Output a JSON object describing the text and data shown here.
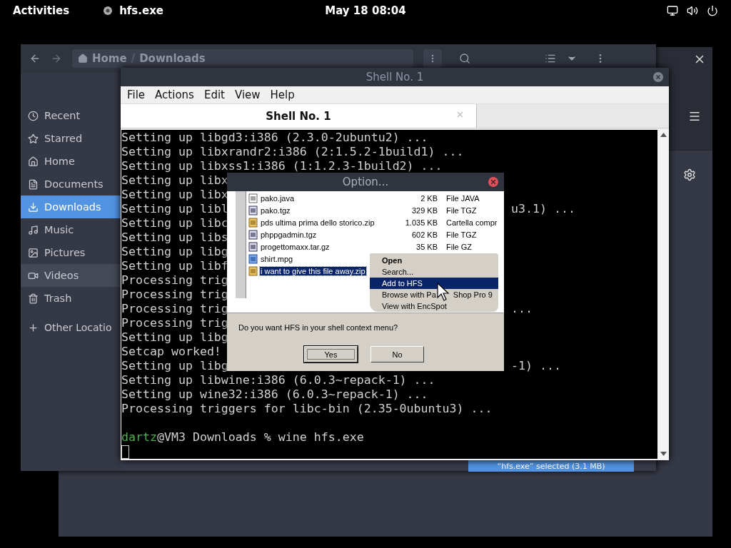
{
  "top_bar": {
    "activities": "Activities",
    "app": "hfs.exe",
    "clock": "May 18 08:04"
  },
  "file_manager": {
    "path": [
      {
        "label": "Home"
      },
      {
        "label": "Downloads"
      }
    ],
    "separator": "/",
    "sidebar": [
      {
        "label": "Recent",
        "selected": false,
        "highlighted": false
      },
      {
        "label": "Starred",
        "selected": false,
        "highlighted": false
      },
      {
        "label": "Home",
        "selected": false,
        "highlighted": false
      },
      {
        "label": "Documents",
        "selected": false,
        "highlighted": false
      },
      {
        "label": "Downloads",
        "selected": true,
        "highlighted": false
      },
      {
        "label": "Music",
        "selected": false,
        "highlighted": false
      },
      {
        "label": "Pictures",
        "selected": false,
        "highlighted": false
      },
      {
        "label": "Videos",
        "selected": false,
        "highlighted": true
      },
      {
        "label": "Trash",
        "selected": false,
        "highlighted": false
      },
      {
        "label": "Other Locatio",
        "selected": false,
        "highlighted": false
      }
    ],
    "status": "“hfs.exe” selected (3.1 MB)"
  },
  "terminal": {
    "title": "Shell No. 1",
    "menu": [
      "File",
      "Actions",
      "Edit",
      "View",
      "Help"
    ],
    "tabs": [
      {
        "label": "Shell No. 1",
        "selected": true
      }
    ],
    "lines": [
      {
        "text": "Setting up libgd3:i386 (2.3.0-2ubuntu2) ..."
      },
      {
        "text": "Setting up libxrandr2:i386 (2:1.5.2-1build1) ..."
      },
      {
        "text": "Setting up libxss1:i386 (1:1.2.3-1build2) ..."
      },
      {
        "text": "Setting up libx"
      },
      {
        "text": "Setting up libx"
      },
      {
        "text": "Setting up libl",
        "tail": "u3.1) ..."
      },
      {
        "text": "Setting up libc"
      },
      {
        "text": "Setting up libs"
      },
      {
        "text": "Setting up libg"
      },
      {
        "text": "Setting up libf"
      },
      {
        "text": "Processing trig"
      },
      {
        "text": "Processing trig"
      },
      {
        "text": "Processing trig",
        "tail": "..."
      },
      {
        "text": "Processing trig"
      },
      {
        "text": "Setting up libg"
      },
      {
        "text": "Setcap worked!"
      },
      {
        "text": "Setting up libg",
        "tail": "-1) ..."
      },
      {
        "text": "Setting up libwine:i386 (6.0.3~repack-1) ..."
      },
      {
        "text": "Setting up wine32:i386 (6.0.3~repack-1) ..."
      },
      {
        "text": "Processing triggers for libc-bin (2.35-0ubuntu3) ..."
      }
    ],
    "prompt": {
      "user": "dartz",
      "rest": "@VM3 Downloads % wine hfs.exe"
    }
  },
  "dialog": {
    "title": "Option...",
    "files": [
      {
        "name": "pako.java",
        "size": "2 KB",
        "type": "File JAVA",
        "kind": "document",
        "selected": false
      },
      {
        "name": "pako.tgz",
        "size": "329 KB",
        "type": "File TGZ",
        "kind": "archive",
        "selected": false
      },
      {
        "name": "pds ultima prima dello storico.zip",
        "size": "1.035 KB",
        "type": "Cartella compr",
        "kind": "zip",
        "selected": false
      },
      {
        "name": "phppgadmin.tgz",
        "size": "602 KB",
        "type": "File TGZ",
        "kind": "archive",
        "selected": false
      },
      {
        "name": "progettomaxx.tar.gz",
        "size": "35 KB",
        "type": "File GZ",
        "kind": "archive",
        "selected": false
      },
      {
        "name": "shirt.mpg",
        "kind": "video",
        "selected": false
      },
      {
        "name": "i want to give this file away.zip",
        "kind": "zip",
        "selected": true
      }
    ],
    "context_menu": [
      {
        "label": "Open",
        "bold": true,
        "selected": false
      },
      {
        "label": "Search...",
        "bold": false,
        "selected": false
      },
      {
        "label": "Add to HFS",
        "bold": false,
        "selected": true
      },
      {
        "label": "Browse with Pa",
        "rest": "Shop Pro 9",
        "bold": false,
        "selected": false
      },
      {
        "label": "View with EncSpot",
        "bold": false,
        "selected": false
      }
    ],
    "message": "Do you want HFS in your shell context menu?",
    "buttons": [
      {
        "label": "Yes",
        "focused": true
      },
      {
        "label": "No",
        "focused": false
      }
    ]
  }
}
